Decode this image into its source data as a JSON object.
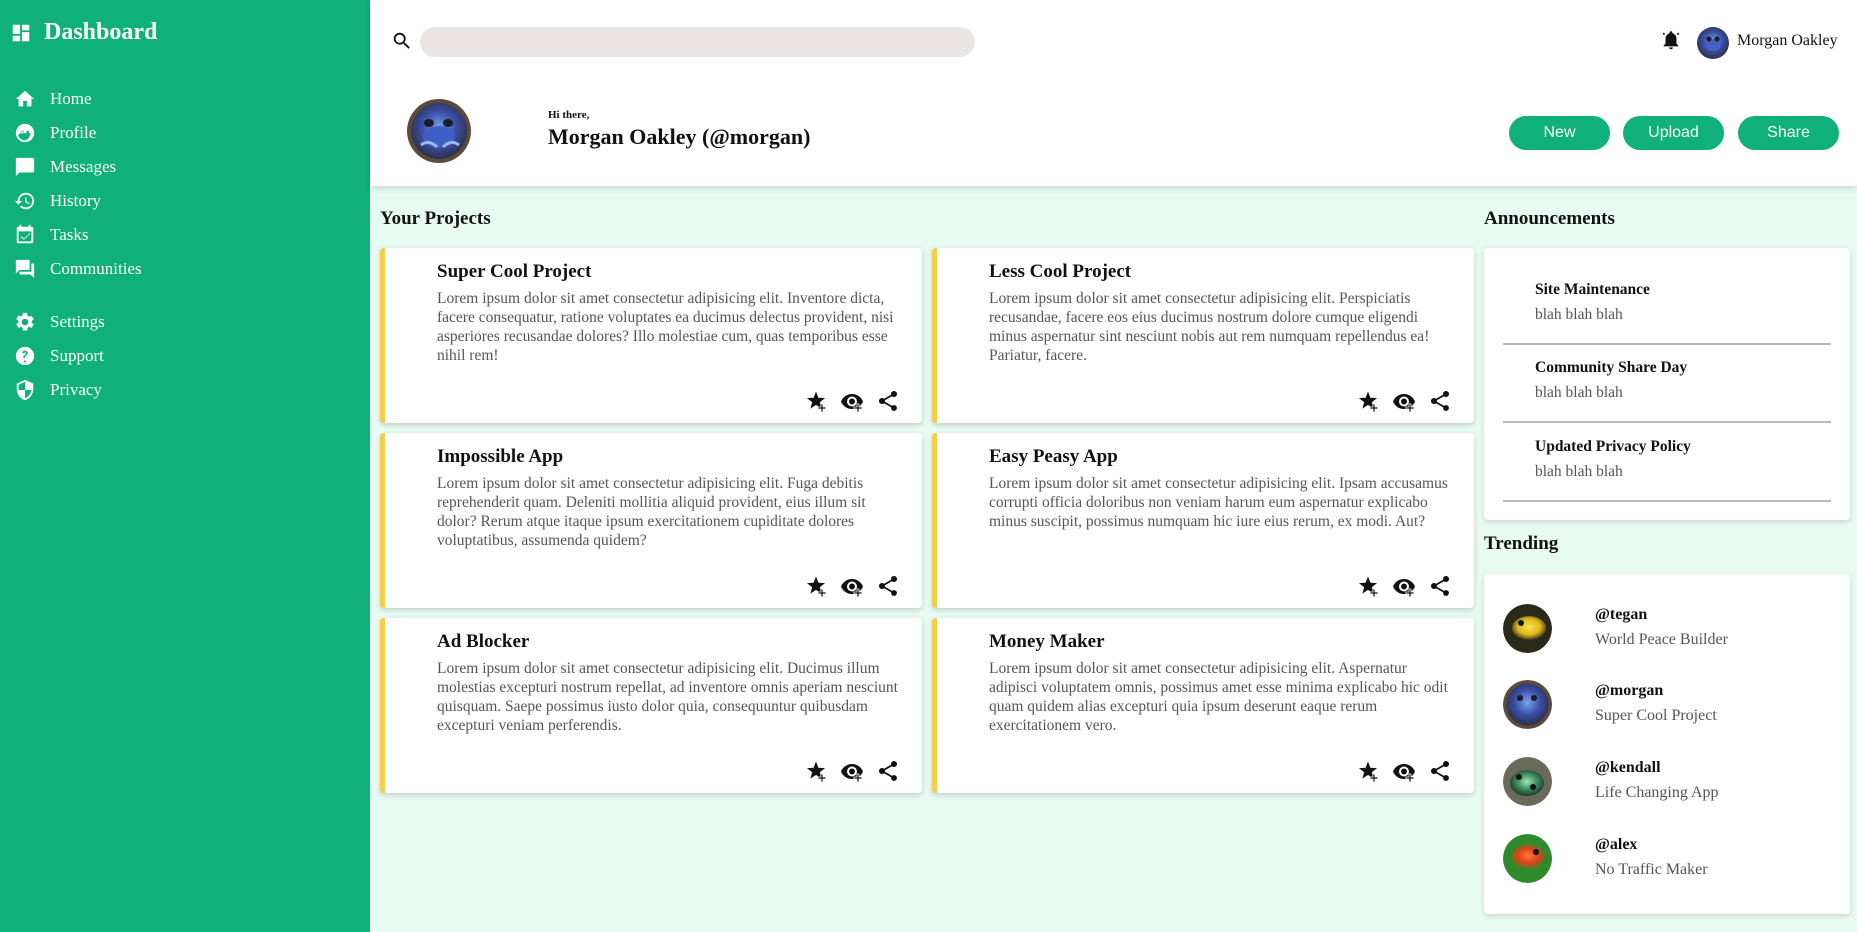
{
  "sidebar": {
    "brand": "Dashboard",
    "items": [
      {
        "label": "Home",
        "icon": "home-icon"
      },
      {
        "label": "Profile",
        "icon": "profile-icon"
      },
      {
        "label": "Messages",
        "icon": "message-icon"
      },
      {
        "label": "History",
        "icon": "history-icon"
      },
      {
        "label": "Tasks",
        "icon": "tasks-icon"
      },
      {
        "label": "Communities",
        "icon": "communities-icon"
      }
    ],
    "items2": [
      {
        "label": "Settings",
        "icon": "gear-icon"
      },
      {
        "label": "Support",
        "icon": "support-icon"
      },
      {
        "label": "Privacy",
        "icon": "shield-icon"
      }
    ]
  },
  "header": {
    "search_placeholder": "",
    "user_name": "Morgan Oakley",
    "greeting": "Hi there,",
    "full_name": "Morgan Oakley (@morgan)",
    "buttons": {
      "new": "New",
      "upload": "Upload",
      "share": "Share"
    }
  },
  "projects": {
    "title": "Your Projects",
    "items": [
      {
        "title": "Super Cool Project",
        "desc": "Lorem ipsum dolor sit amet consectetur adipisicing elit. Inventore dicta, facere consequatur, ratione voluptates ea ducimus delectus provident, nisi asperiores recusandae dolores? Illo molestiae cum, quas temporibus esse nihil rem!"
      },
      {
        "title": "Less Cool Project",
        "desc": "Lorem ipsum dolor sit amet consectetur adipisicing elit. Perspiciatis recusandae, facere eos eius ducimus nostrum dolore cumque eligendi minus aspernatur sint nesciunt nobis aut rem numquam repellendus ea! Pariatur, facere."
      },
      {
        "title": "Impossible App",
        "desc": "Lorem ipsum dolor sit amet consectetur adipisicing elit. Fuga debitis reprehenderit quam. Deleniti mollitia aliquid provident, eius illum sit dolor? Rerum atque itaque ipsum exercitationem cupiditate dolores voluptatibus, assumenda quidem?"
      },
      {
        "title": "Easy Peasy App",
        "desc": "Lorem ipsum dolor sit amet consectetur adipisicing elit. Ipsam accusamus corrupti officia doloribus non veniam harum eum aspernatur explicabo minus suscipit, possimus numquam hic iure eius rerum, ex modi. Aut?"
      },
      {
        "title": "Ad Blocker",
        "desc": "Lorem ipsum dolor sit amet consectetur adipisicing elit. Ducimus illum molestias excepturi nostrum repellat, ad inventore omnis aperiam nesciunt quisquam. Saepe possimus iusto dolor quia, consequuntur quibusdam excepturi veniam perferendis."
      },
      {
        "title": "Money Maker",
        "desc": "Lorem ipsum dolor sit amet consectetur adipisicing elit. Aspernatur adipisci voluptatem omnis, possimus amet esse minima explicabo hic odit quam quidem alias excepturi quia ipsum deserunt eaque rerum exercitationem vero."
      }
    ]
  },
  "announcements": {
    "title": "Announcements",
    "items": [
      {
        "title": "Site Maintenance",
        "body": "blah blah blah"
      },
      {
        "title": "Community Share Day",
        "body": "blah blah blah"
      },
      {
        "title": "Updated Privacy Policy",
        "body": "blah blah blah"
      }
    ]
  },
  "trending": {
    "title": "Trending",
    "items": [
      {
        "handle": "@tegan",
        "sub": "World Peace Builder"
      },
      {
        "handle": "@morgan",
        "sub": "Super Cool Project"
      },
      {
        "handle": "@kendall",
        "sub": "Life Changing App"
      },
      {
        "handle": "@alex",
        "sub": "No Traffic Maker"
      }
    ]
  },
  "colors": {
    "accent": "#10b07a",
    "card_border": "#f3cf49",
    "background": "#e8fbf3"
  }
}
